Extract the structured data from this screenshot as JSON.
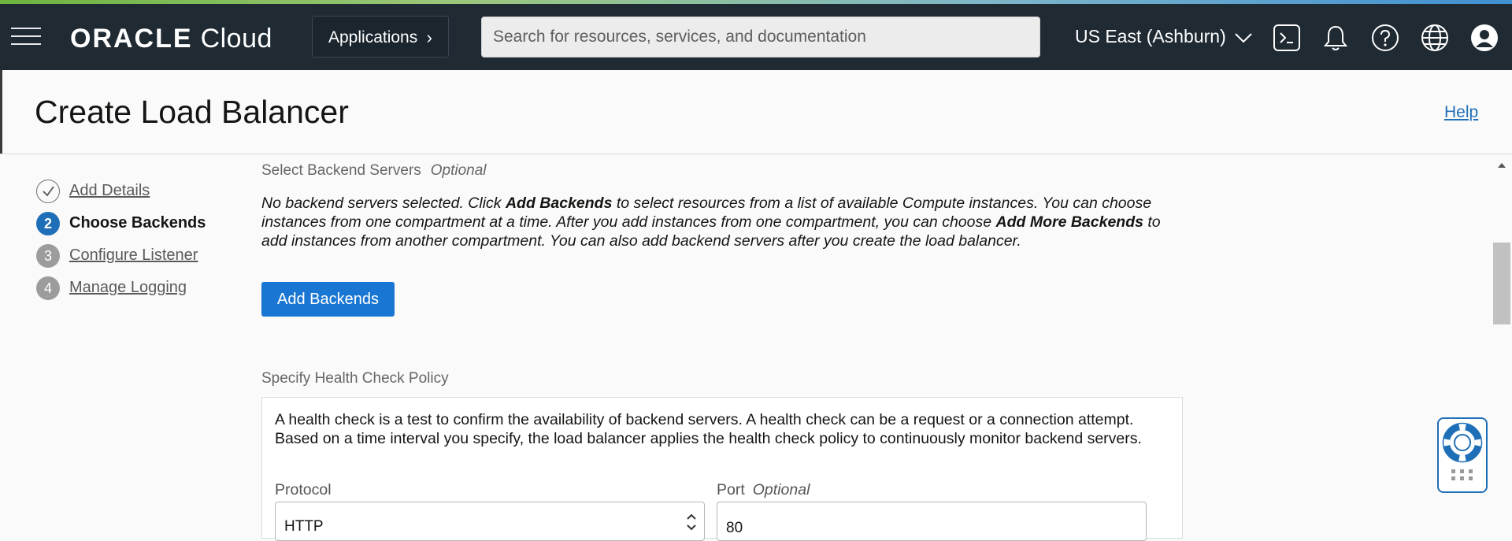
{
  "header": {
    "logo_brand": "ORACLE",
    "logo_product": "Cloud",
    "applications_label": "Applications",
    "search_placeholder": "Search for resources, services, and documentation",
    "region_label": "US East (Ashburn)"
  },
  "page": {
    "title": "Create Load Balancer",
    "help_label": "Help"
  },
  "steps": [
    {
      "number": "",
      "label": "Add Details",
      "state": "completed"
    },
    {
      "number": "2",
      "label": "Choose Backends",
      "state": "current"
    },
    {
      "number": "3",
      "label": "Configure Listener",
      "state": "pending"
    },
    {
      "number": "4",
      "label": "Manage Logging",
      "state": "pending"
    }
  ],
  "backends": {
    "section_label": "Select Backend Servers",
    "optional_label": "Optional",
    "text_1": "No backend servers selected. Click ",
    "bold_1": "Add Backends",
    "text_2": " to select resources from a list of available Compute instances. You can choose instances from one compartment at a time. After you add instances from one compartment, you can choose ",
    "bold_2": "Add More Backends",
    "text_3": " to add instances from another compartment. You can also add backend servers after you create the load balancer.",
    "add_button_label": "Add Backends"
  },
  "health_check": {
    "section_label": "Specify Health Check Policy",
    "description": "A health check is a test to confirm the availability of backend servers. A health check can be a request or a connection attempt. Based on a time interval you specify, the load balancer applies the health check policy to continuously monitor backend servers.",
    "protocol_label": "Protocol",
    "protocol_value": "HTTP",
    "port_label": "Port",
    "port_optional_label": "Optional",
    "port_value": "80"
  },
  "icons": {
    "menu": "hamburger-menu-icon",
    "cloud_shell": "cloud-shell-icon",
    "notifications": "bell-icon",
    "help": "question-icon",
    "language": "globe-icon",
    "profile": "user-avatar-icon",
    "support": "life-ring-icon"
  },
  "colors": {
    "topbar": "#1f2a33",
    "accent": "#1f6fb8",
    "primary_button": "#1976d2"
  }
}
